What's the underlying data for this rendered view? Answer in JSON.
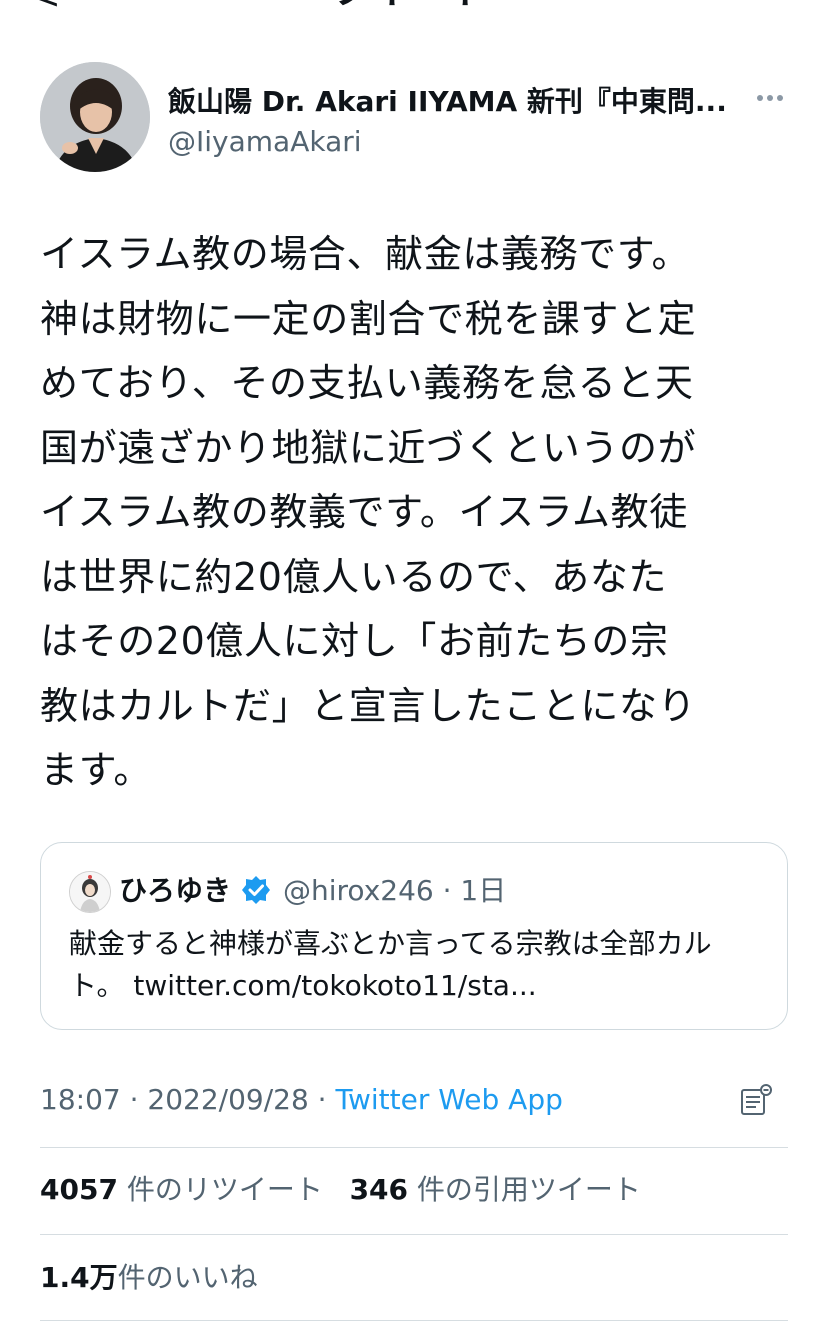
{
  "topbar": {
    "back_glyph": "<",
    "title": "ツイート"
  },
  "author": {
    "display_name": "飯山陽 Dr. Akari IIYAMA 新刊『中東問...",
    "handle": "@IiyamaAkari"
  },
  "tweet": {
    "text": "イスラム教の場合、献金は義務です。\n神は財物に一定の割合で税を課すと定\nめており、その支払い義務を怠ると天\n国が遠ざかり地獄に近づくというのが\nイスラム教の教義です。イスラム教徒\nは世界に約20億人いるので、あなた\nはその20億人に対し「お前たちの宗\n教はカルトだ」と宣言したことになり\nます。"
  },
  "quote": {
    "name": "ひろゆき",
    "meta": "@hirox246 · 1日",
    "text": "献金すると神様が喜ぶとか言ってる宗教は全部カル\nト。 twitter.com/tokokoto11/sta..."
  },
  "meta": {
    "timestamp": "18:07 · 2022/09/28 · ",
    "source": "Twitter Web App"
  },
  "stats": {
    "retweets_count": "4057",
    "retweets_label": "件のリツイート",
    "quotes_count": "346",
    "quotes_label": "件の引用ツイート",
    "likes_count": "1.4万",
    "likes_label": "件のいいね"
  },
  "icons": {
    "more": "more-icon",
    "verified": "verified-icon",
    "analytics": "analytics-icon"
  },
  "colors": {
    "link": "#1d9bf0",
    "secondary_text": "#536471",
    "primary_text": "#0f1419",
    "border": "#cfd9de"
  }
}
